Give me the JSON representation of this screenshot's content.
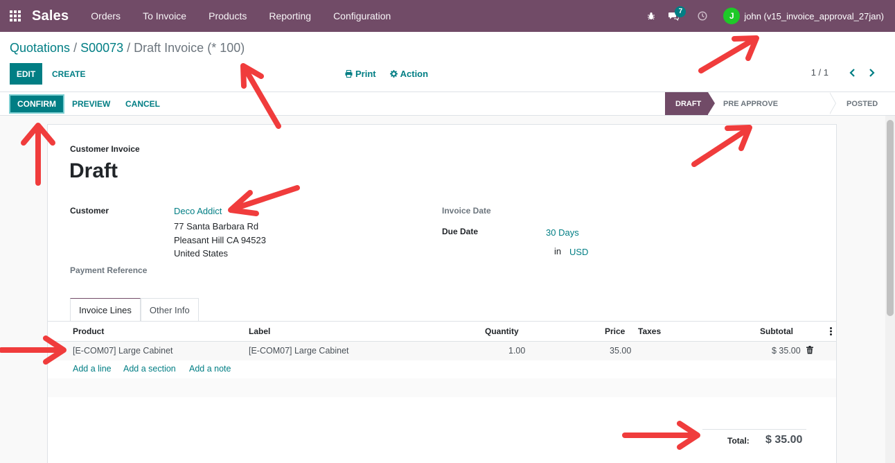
{
  "navbar": {
    "app_name": "Sales",
    "menu": [
      "Orders",
      "To Invoice",
      "Products",
      "Reporting",
      "Configuration"
    ],
    "messages_count": "7",
    "user_initial": "J",
    "user_name": "john (v15_invoice_approval_27jan)",
    "icons": [
      "apps-grid-icon",
      "bug-icon",
      "chat-icon",
      "clock-icon"
    ]
  },
  "control": {
    "breadcrumb": [
      "Quotations",
      "S00073",
      "Draft Invoice (* 100)"
    ],
    "edit_label": "EDIT",
    "create_label": "CREATE",
    "print_label": "Print",
    "action_label": "Action",
    "pager": "1 / 1"
  },
  "statusbar": {
    "confirm_label": "CONFIRM",
    "preview_label": "PREVIEW",
    "cancel_label": "CANCEL",
    "stages": [
      "DRAFT",
      "PRE APPROVE",
      "POSTED"
    ],
    "active_stage": "DRAFT"
  },
  "form": {
    "doc_type": "Customer Invoice",
    "state": "Draft",
    "customer_label": "Customer",
    "customer_name": "Deco Addict",
    "address": [
      "77 Santa Barbara Rd",
      "Pleasant Hill CA 94523",
      "United States"
    ],
    "payment_ref_label": "Payment Reference",
    "invoice_date_label": "Invoice Date",
    "due_date_label": "Due Date",
    "due_date_value": "30 Days",
    "currency_prefix": "in",
    "currency": "USD"
  },
  "tabs": [
    "Invoice Lines",
    "Other Info"
  ],
  "table": {
    "columns": [
      "Product",
      "Label",
      "Quantity",
      "Price",
      "Taxes",
      "Subtotal"
    ],
    "rows": [
      {
        "product": "[E-COM07] Large Cabinet",
        "label": "[E-COM07] Large Cabinet",
        "quantity": "1.00",
        "price": "35.00",
        "taxes": "",
        "subtotal": "$ 35.00"
      }
    ],
    "add_links": [
      "Add a line",
      "Add a section",
      "Add a note"
    ]
  },
  "totals": {
    "label": "Total:",
    "value": "$ 35.00"
  },
  "colors": {
    "brand": "#714b67",
    "accent": "#017e84",
    "annotation": "#f03c3c"
  }
}
